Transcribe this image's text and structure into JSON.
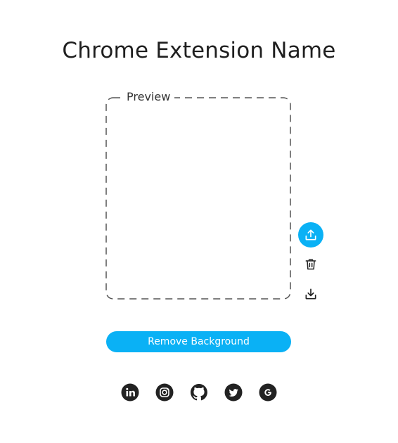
{
  "header": {
    "title": "Chrome Extension Name"
  },
  "preview": {
    "label": "Preview"
  },
  "actions": {
    "upload_icon": "upload-icon",
    "delete_icon": "trash-icon",
    "download_icon": "download-icon"
  },
  "main": {
    "remove_background_label": "Remove Background"
  },
  "socials": [
    {
      "name": "linkedin-icon"
    },
    {
      "name": "instagram-icon"
    },
    {
      "name": "github-icon"
    },
    {
      "name": "twitter-icon"
    },
    {
      "name": "google-icon"
    }
  ],
  "colors": {
    "accent": "#0ab1f5",
    "text": "#1f1f1f",
    "icon": "#222222",
    "dash": "#555555"
  }
}
